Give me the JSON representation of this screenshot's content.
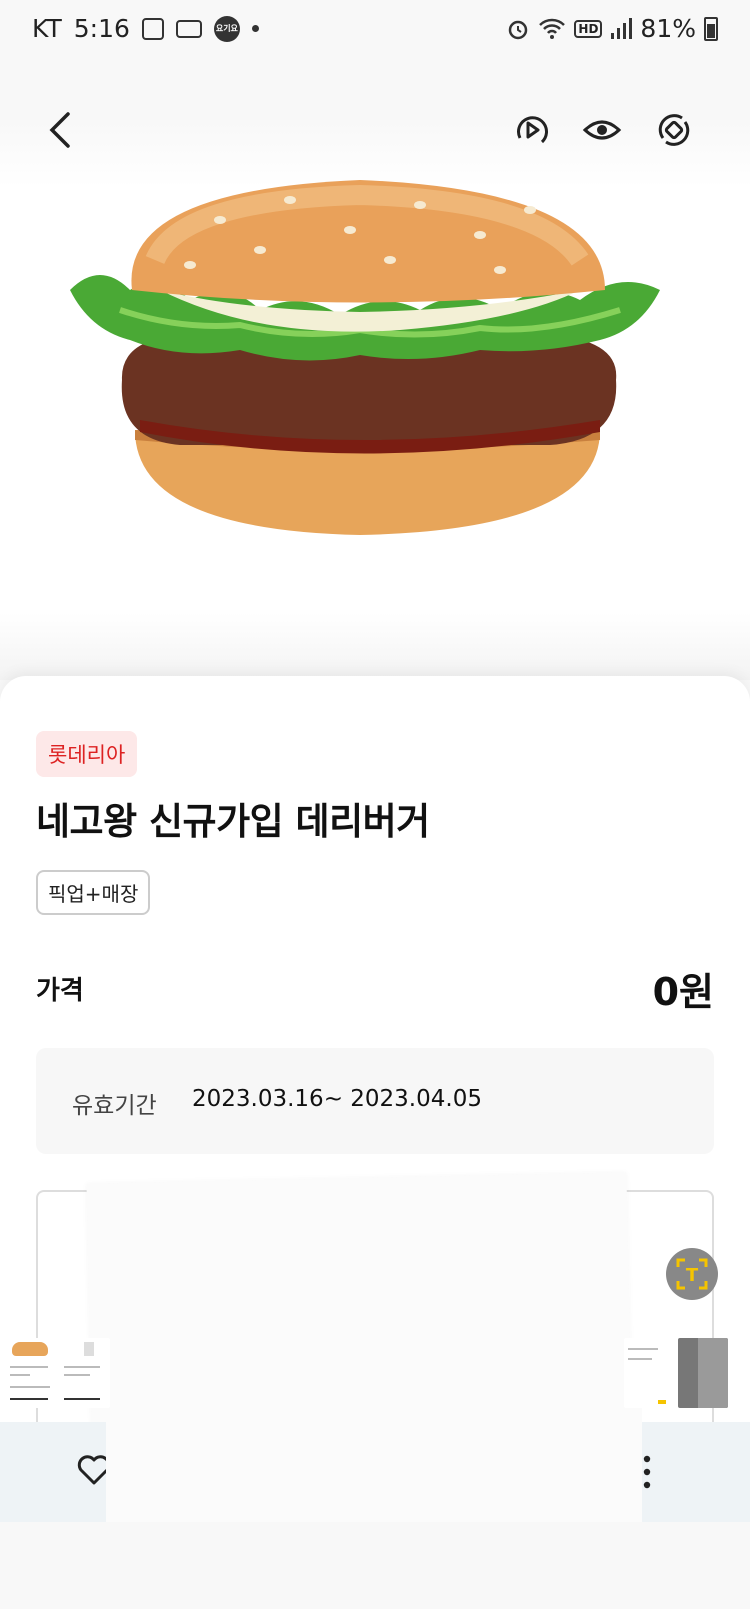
{
  "status_bar": {
    "carrier": "KT",
    "time": "5:16",
    "battery": "81%",
    "hd_label": "HD",
    "app_badge": "요기요",
    "icons": [
      "gallery-icon",
      "voicemail-icon",
      "app-badge-icon",
      "dot-icon",
      "alarm-icon",
      "wifi-icon",
      "hd-icon",
      "signal-icon",
      "battery-icon"
    ]
  },
  "nav": {
    "icons": [
      "back-icon",
      "video-play-icon",
      "eye-icon",
      "rotate-icon"
    ]
  },
  "product": {
    "brand": "롯데리아",
    "title": "네고왕 신규가입 데리버거",
    "tag": "픽업+매장",
    "price_label": "가격",
    "price_value": "0원",
    "validity_label": "유효기간",
    "validity_dates": "2023.03.16~ 2023.04.05"
  },
  "floating": {
    "scan_label": "T"
  },
  "bottom_bar": {
    "icons": [
      "heart-icon",
      "more-vertical-icon"
    ]
  },
  "colors": {
    "brand_text": "#dd2222",
    "brand_bg": "#fde8e8",
    "scan_accent": "#f5c400"
  }
}
